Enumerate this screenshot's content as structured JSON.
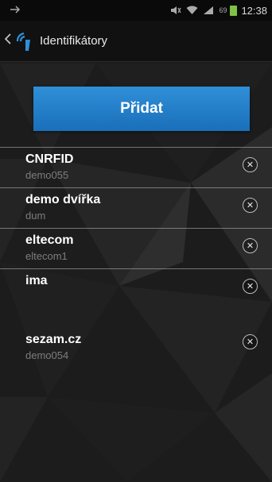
{
  "status_bar": {
    "battery_percent": "69",
    "time": "12:38"
  },
  "action_bar": {
    "back_icon": "chevron-left-icon",
    "app_icon": "nfc-signal-icon",
    "title": "Identifikátory"
  },
  "add_button": {
    "label": "Přidat"
  },
  "identifiers": [
    {
      "name": "CNRFID",
      "subtitle": "demo055"
    },
    {
      "name": "demo dvířka",
      "subtitle": "dum"
    },
    {
      "name": "eltecom",
      "subtitle": "eltecom1"
    },
    {
      "name": "ima",
      "subtitle": ""
    },
    {
      "name": "sezam.cz",
      "subtitle": "demo054"
    }
  ],
  "colors": {
    "accent": "#2f8fd8",
    "background": "#1b1b1b",
    "subtitle_text": "#7d7d7d"
  }
}
